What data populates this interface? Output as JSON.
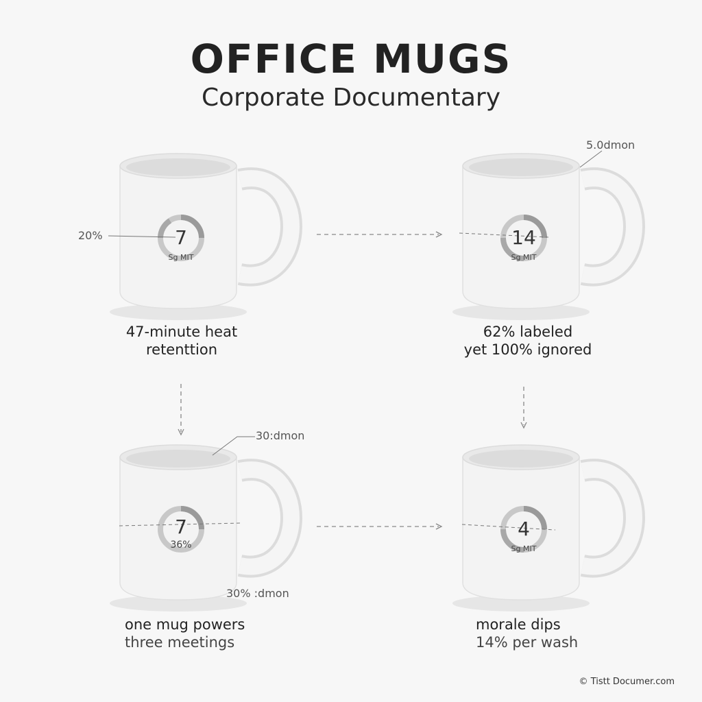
{
  "header": {
    "title": "OFFICE MUGS",
    "subtitle": "Corporate Documentary"
  },
  "mugs": [
    {
      "dial_value": "7",
      "dial_sub": "Sg MIT",
      "annotation": "20%",
      "caption": [
        "47-minute heat",
        "retenttion"
      ]
    },
    {
      "dial_value": "14",
      "dial_sub": "Sg MIT",
      "annotation": "5.0dmon",
      "caption": [
        "62% labeled",
        "yet 100% ignored"
      ]
    },
    {
      "dial_value": "7",
      "dial_sub": "36%",
      "annotation": "30:dmon",
      "annotation_lower": "30% :dmon",
      "caption": [
        "one mug powers",
        "three meetings"
      ]
    },
    {
      "dial_value": "4",
      "dial_sub": "Sg MIT",
      "caption": [
        "morale dips",
        "14% per wash"
      ]
    }
  ],
  "footer": {
    "credit": "© Tistt Documer.com"
  }
}
